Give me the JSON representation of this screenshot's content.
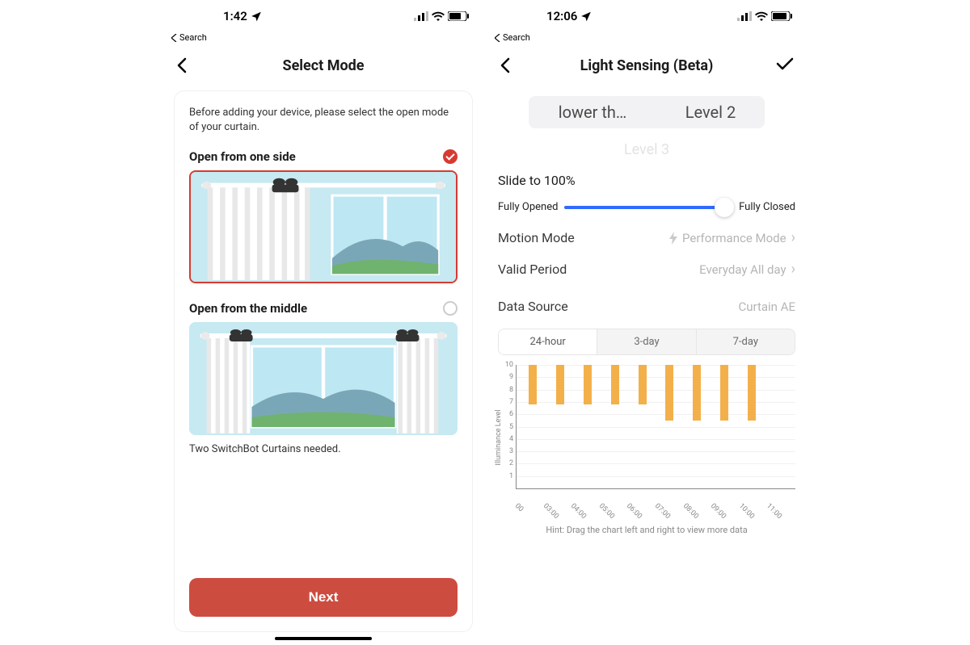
{
  "brand": {
    "accent_red": "#cd4c40",
    "slider_blue": "#2f6bff",
    "bar_orange": "#f3b04a"
  },
  "screen1": {
    "status_time": "1:42",
    "breadcrumb": "Search",
    "title": "Select Mode",
    "intro": "Before adding your device, please select the open mode of your curtain.",
    "option1": {
      "label": "Open from one side",
      "selected": true
    },
    "option2": {
      "label": "Open from the middle",
      "selected": false,
      "helper": "Two SwitchBot Curtains needed."
    },
    "next_label": "Next"
  },
  "screen2": {
    "status_time": "12:06",
    "breadcrumb": "Search",
    "title": "Light Sensing (Beta)",
    "picker": {
      "left_truncated": "lower th…",
      "right": "Level 2",
      "ghost_below": "Level 3"
    },
    "slider": {
      "title": "Slide to 100%",
      "left": "Fully Opened",
      "right": "Fully Closed",
      "value_pct": 100
    },
    "motion_mode": {
      "label": "Motion Mode",
      "value": "Performance Mode"
    },
    "valid_period": {
      "label": "Valid Period",
      "value": "Everyday  All day"
    },
    "data_source": {
      "label": "Data Source",
      "value": "Curtain AE"
    },
    "segments": [
      "24-hour",
      "3-day",
      "7-day"
    ],
    "segment_active_index": 0,
    "chart_data": {
      "type": "bar",
      "ylabel": "Illuminance Level",
      "ylim": [
        0,
        10
      ],
      "y_ticks": [
        1,
        2,
        3,
        4,
        5,
        6,
        7,
        8,
        9,
        10
      ],
      "categories": [
        "00",
        "03:00",
        "04:00",
        "05:00",
        "06:00",
        "07:00",
        "08:00",
        "09:00",
        "10:00",
        "11:00"
      ],
      "values": [
        3.2,
        3.2,
        3.2,
        3.2,
        3.2,
        4.5,
        4.5,
        4.5,
        4.5,
        null
      ]
    },
    "hint": "Hint: Drag the chart left and right to view more data"
  }
}
